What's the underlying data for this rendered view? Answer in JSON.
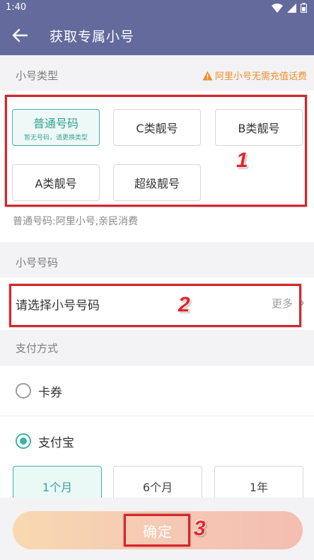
{
  "status_bar": {
    "time": "1:40"
  },
  "app_bar": {
    "title": "获取专属小号"
  },
  "number_type": {
    "section_label": "小号类型",
    "warning": "阿里小号无需充值话费",
    "options": [
      {
        "label": "普通号码",
        "sub": "暂无号码，请更换类型",
        "selected": true
      },
      {
        "label": "C类靓号",
        "selected": false
      },
      {
        "label": "B类靓号",
        "selected": false
      },
      {
        "label": "A类靓号",
        "selected": false
      },
      {
        "label": "超级靓号",
        "selected": false
      }
    ],
    "description": "普通号码:阿里小号,亲民消费"
  },
  "number_select": {
    "section_label": "小号号码",
    "placeholder": "请选择小号号码",
    "more": "更多"
  },
  "payment": {
    "section_label": "支付方式",
    "methods": [
      {
        "label": "卡券",
        "checked": false
      },
      {
        "label": "支付宝",
        "checked": true
      }
    ],
    "periods": [
      {
        "label": "1个月",
        "selected": true
      },
      {
        "label": "6个月",
        "selected": false
      },
      {
        "label": "1年",
        "selected": false
      }
    ]
  },
  "confirm_label": "确定",
  "annotations": {
    "marker_1": "1",
    "marker_2": "2",
    "marker_3": "3"
  },
  "colors": {
    "header": "#646a9c",
    "accent": "#3fb2a2",
    "warning": "#f08e2a",
    "annotation": "#d9242a"
  }
}
